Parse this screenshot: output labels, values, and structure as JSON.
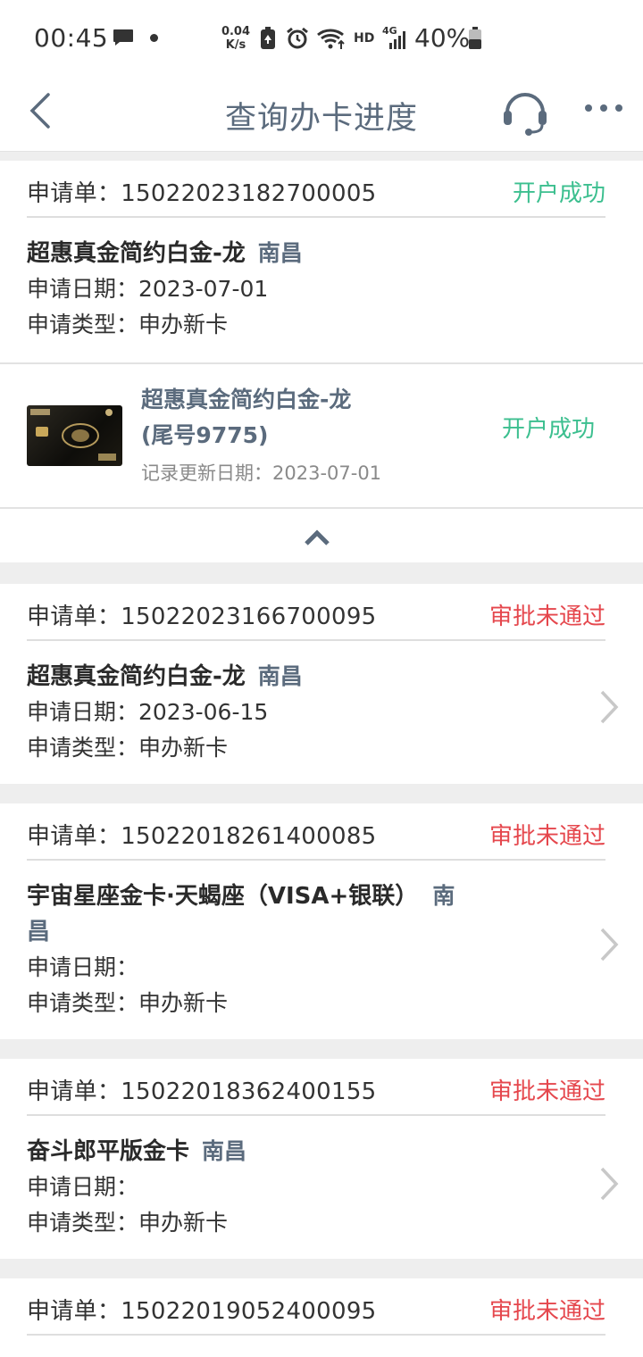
{
  "status_bar": {
    "time": "00:45",
    "speed_value": "0.04",
    "speed_unit": "K/s",
    "network_hd": "HD",
    "network_4g": "4G",
    "battery": "40%"
  },
  "header": {
    "title": "查询办卡进度",
    "back_icon": "back-chevron-icon",
    "support_icon": "headset-icon",
    "more_icon": "more-dots-icon"
  },
  "colors": {
    "success": "#3cbf8f",
    "failure": "#e5474d",
    "accent_text": "#5b6b7d"
  },
  "applications": [
    {
      "order_label": "申请单：15022023182700005",
      "status": "开户成功",
      "card_name": "超惠真金简约白金-龙",
      "city": "南昌",
      "date_line": "申请日期：2023-07-01",
      "type_line": "申请类型：申办新卡",
      "expanded": {
        "card_name_line1": "超惠真金简约白金-龙",
        "card_name_line2": "(尾号9775)",
        "updated_line": "记录更新日期：2023-07-01",
        "status": "开户成功"
      }
    },
    {
      "order_label": "申请单：15022023166700095",
      "status": "审批未通过",
      "card_name": "超惠真金简约白金-龙",
      "city": "南昌",
      "date_line": "申请日期：2023-06-15",
      "type_line": "申请类型：申办新卡"
    },
    {
      "order_label": "申请单：15022018261400085",
      "status": "审批未通过",
      "card_name": "宇宙星座金卡·天蝎座（VISA+银联）",
      "city_part1": "南",
      "city_part2": "昌",
      "date_line": "申请日期：",
      "type_line": "申请类型：申办新卡"
    },
    {
      "order_label": "申请单：15022018362400155",
      "status": "审批未通过",
      "card_name": "奋斗郎平版金卡",
      "city": "南昌",
      "date_line": "申请日期：",
      "type_line": "申请类型：申办新卡"
    },
    {
      "order_label": "申请单：15022019052400095",
      "status": "审批未通过"
    }
  ]
}
